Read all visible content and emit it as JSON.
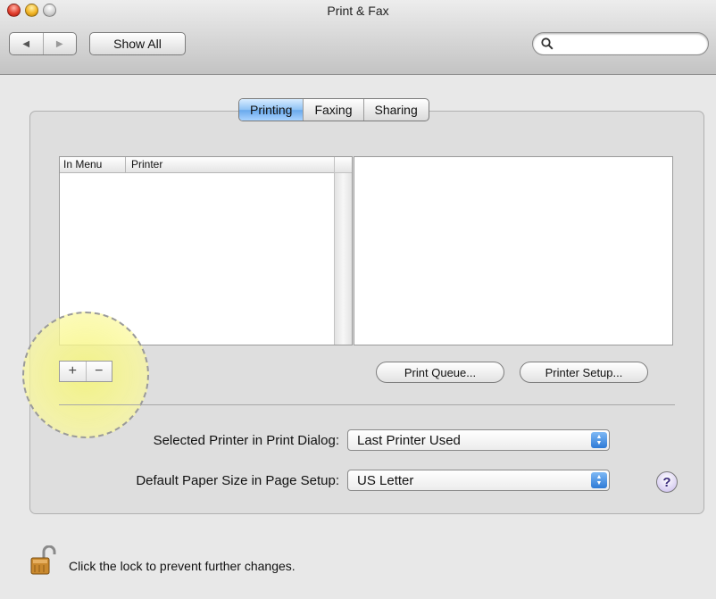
{
  "window": {
    "title": "Print & Fax"
  },
  "toolbar": {
    "back_icon": "triangle-left",
    "forward_icon": "triangle-right",
    "show_all_label": "Show All",
    "search_value": "",
    "search_placeholder": ""
  },
  "tabs": [
    {
      "label": "Printing",
      "active": true
    },
    {
      "label": "Faxing",
      "active": false
    },
    {
      "label": "Sharing",
      "active": false
    }
  ],
  "printer_list": {
    "columns": [
      "In Menu",
      "Printer"
    ],
    "rows": []
  },
  "list_controls": {
    "add_label": "+",
    "remove_label": "−"
  },
  "buttons": {
    "print_queue": "Print Queue...",
    "printer_setup": "Printer Setup..."
  },
  "selected_printer": {
    "label": "Selected Printer in Print Dialog:",
    "value": "Last Printer Used"
  },
  "paper_size": {
    "label": "Default Paper Size in Page Setup:",
    "value": "US Letter"
  },
  "help_label": "?",
  "lock": {
    "message": "Click the lock to prevent further changes."
  },
  "colors": {
    "tab_active": "#7fb4ee",
    "highlight": "#f6f48a",
    "popup_arrow": "#2e7ad6"
  }
}
